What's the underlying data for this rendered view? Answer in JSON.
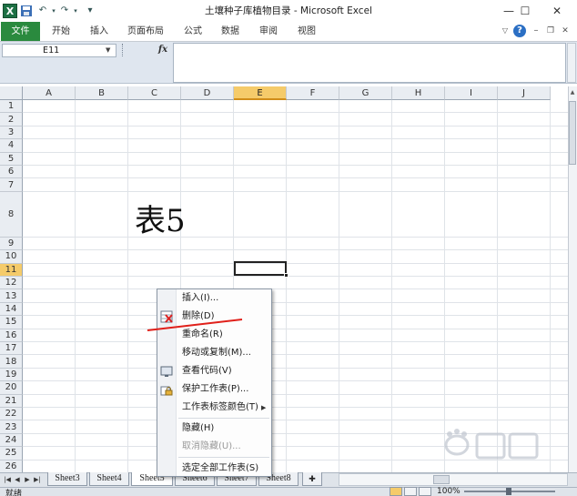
{
  "app": {
    "title": "土壤种子库植物目录 - Microsoft Excel",
    "logo_letter": "X"
  },
  "quick_access": {
    "save": "💾",
    "undo": "↶",
    "redo": "↷",
    "customize": "▾"
  },
  "window_controls": {
    "minimize": "—",
    "maximize": "☐",
    "close": "✕"
  },
  "ribbon": {
    "file_tab": "文件",
    "tabs": [
      "开始",
      "插入",
      "页面布局",
      "公式",
      "数据",
      "审阅",
      "视图"
    ],
    "help": "?"
  },
  "formula_bar": {
    "name_box": "E11",
    "fx": "fx",
    "value": ""
  },
  "columns": [
    "A",
    "B",
    "C",
    "D",
    "E",
    "F",
    "G",
    "H",
    "I",
    "J"
  ],
  "selected_column": "E",
  "rows": [
    "1",
    "2",
    "3",
    "4",
    "5",
    "6",
    "7",
    "8",
    "9",
    "10",
    "11",
    "12",
    "13",
    "14",
    "15",
    "16",
    "17",
    "18",
    "19",
    "20",
    "21",
    "22",
    "23",
    "24",
    "25",
    "26"
  ],
  "selected_row": "11",
  "cell_content": {
    "ref": "C8",
    "text": "表5"
  },
  "sheet_tabs": {
    "nav": [
      "◀◀",
      "◀",
      "▶",
      "▶▶"
    ],
    "tabs": [
      "Sheet3",
      "Sheet4",
      "Sheet5",
      "Sheet6",
      "Sheet7",
      "Sheet8"
    ],
    "active": "Sheet5"
  },
  "status_bar": {
    "ready": "就绪",
    "zoom": "100%"
  },
  "context_menu": {
    "items": [
      {
        "label": "插入(I)...",
        "icon": "",
        "disabled": false
      },
      {
        "label": "删除(D)",
        "icon": "delete-sheet-icon",
        "disabled": false
      },
      {
        "label": "重命名(R)",
        "icon": "",
        "disabled": false
      },
      {
        "label": "移动或复制(M)...",
        "icon": "",
        "disabled": false
      },
      {
        "label": "查看代码(V)",
        "icon": "view-code-icon",
        "disabled": false
      },
      {
        "label": "保护工作表(P)...",
        "icon": "protect-sheet-icon",
        "disabled": false
      },
      {
        "label": "工作表标签颜色(T)",
        "icon": "",
        "disabled": false
      },
      {
        "label": "隐藏(H)",
        "icon": "",
        "disabled": false
      },
      {
        "label": "取消隐藏(U)...",
        "icon": "",
        "disabled": true
      },
      {
        "label": "选定全部工作表(S)",
        "icon": "",
        "disabled": false
      }
    ]
  },
  "accent_colors": {
    "excel_green": "#2a8a3e",
    "selection": "#f5cb6a",
    "annotation_red": "#e0201a"
  }
}
